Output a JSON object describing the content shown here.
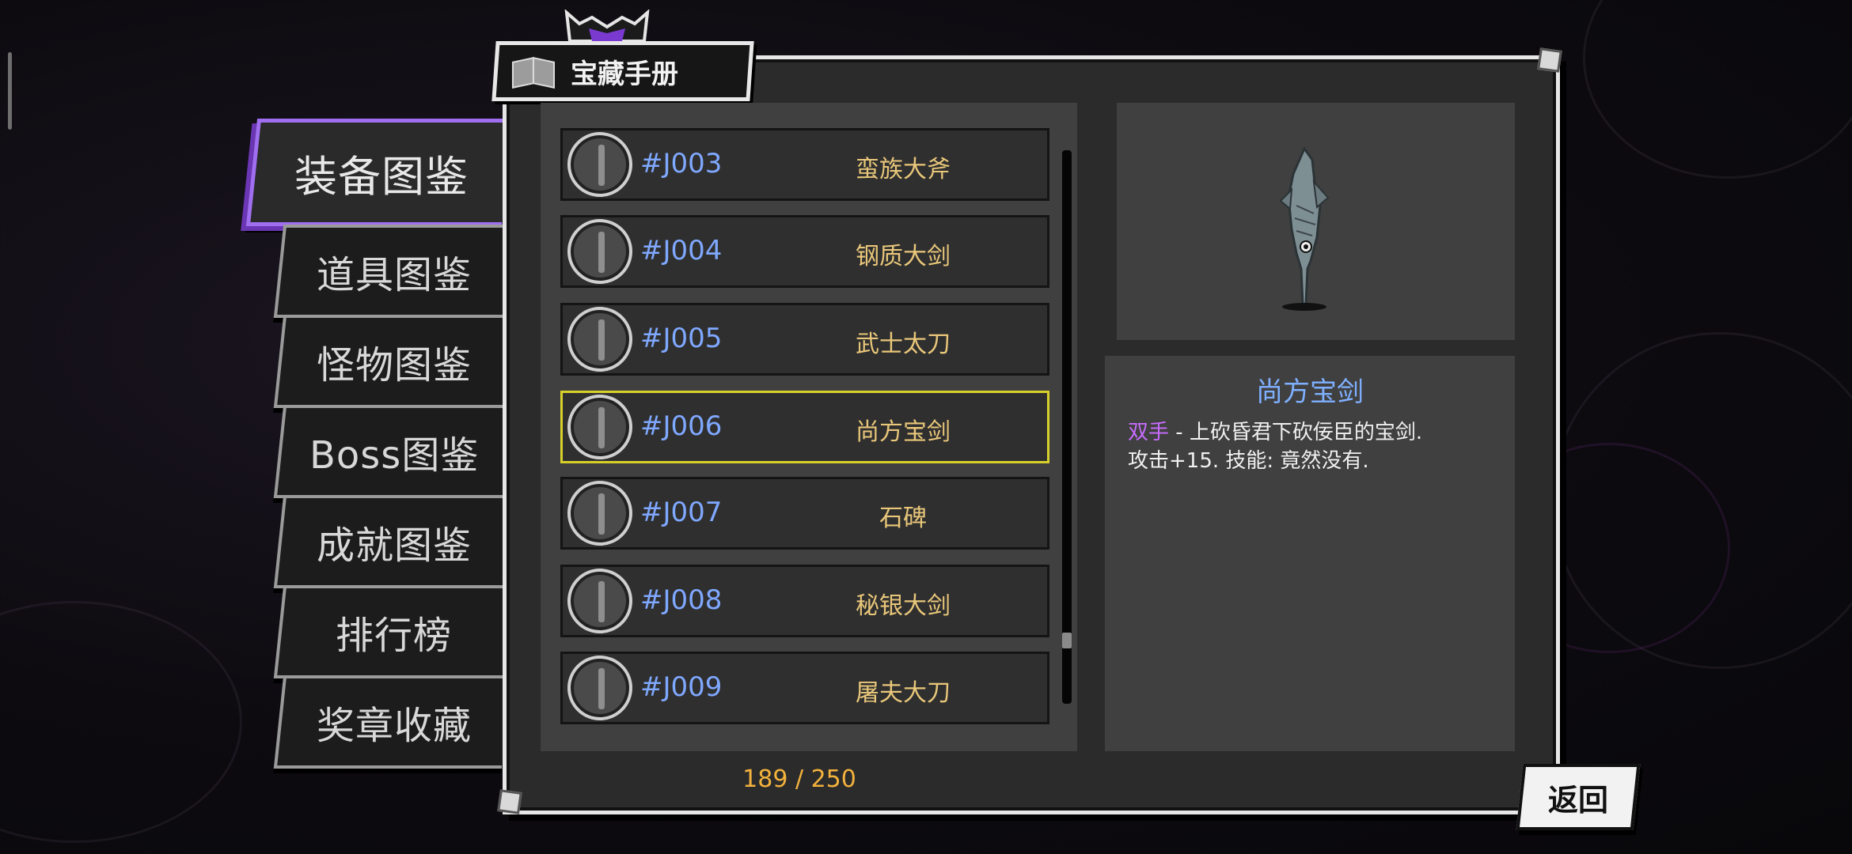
{
  "window": {
    "title": "宝藏手册"
  },
  "sidebar": {
    "items": [
      {
        "label": "装备图鉴",
        "active": true
      },
      {
        "label": "道具图鉴"
      },
      {
        "label": "怪物图鉴"
      },
      {
        "label": "Boss图鉴"
      },
      {
        "label": "成就图鉴"
      },
      {
        "label": "排行榜"
      },
      {
        "label": "奖章收藏"
      }
    ]
  },
  "list": {
    "items": [
      {
        "code": "#J003",
        "name": "蛮族大斧",
        "icon": "axe-icon"
      },
      {
        "code": "#J004",
        "name": "钢质大剑",
        "icon": "sword-icon"
      },
      {
        "code": "#J005",
        "name": "武士太刀",
        "icon": "katana-icon"
      },
      {
        "code": "#J006",
        "name": "尚方宝剑",
        "icon": "fish-sword-icon",
        "selected": true
      },
      {
        "code": "#J007",
        "name": "石碑",
        "icon": "stone-tablet-icon"
      },
      {
        "code": "#J008",
        "name": "秘银大剑",
        "icon": "sword-icon"
      },
      {
        "code": "#J009",
        "name": "屠夫大刀",
        "icon": "cleaver-icon"
      }
    ],
    "counter": "189 / 250"
  },
  "detail": {
    "title": "尚方宝剑",
    "tag": "双手",
    "line1_rest": " - 上砍昏君下砍佞臣的宝剑.",
    "line2": "攻击+15. 技能: 竟然没有."
  },
  "back_label": "返回",
  "colors": {
    "accent_purple": "#a06ef0",
    "code_blue": "#7fa8ff",
    "name_gold": "#e9c77a",
    "counter_orange": "#f3b23c",
    "selected_yellow": "#d8d02a"
  }
}
